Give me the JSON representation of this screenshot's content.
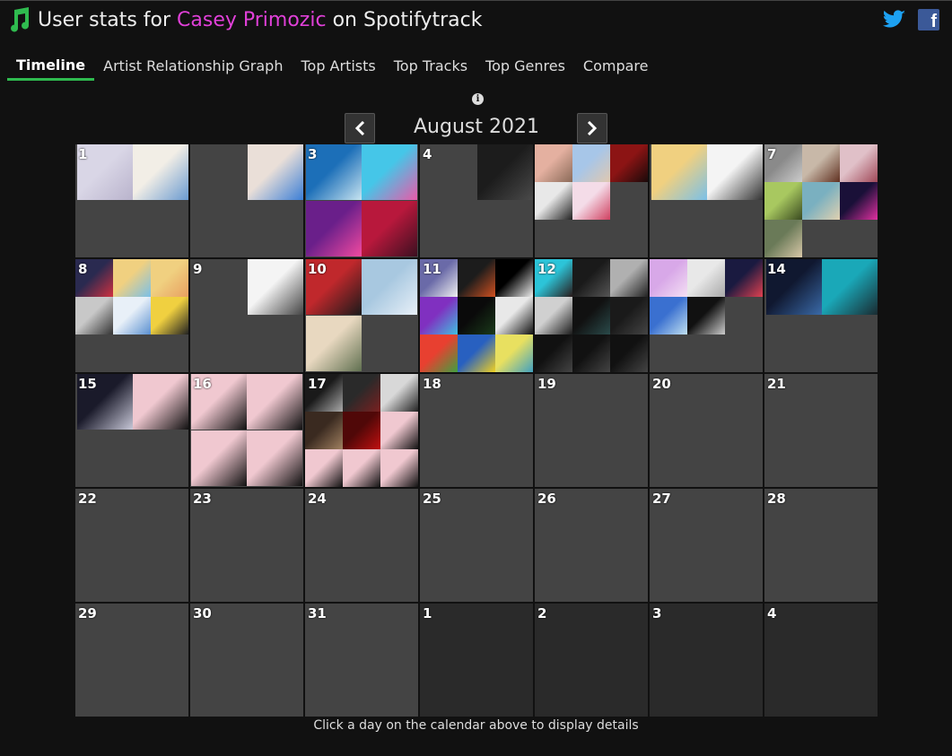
{
  "header": {
    "prefix": "User stats for ",
    "username": "Casey Primozic",
    "suffix": " on Spotifytrack"
  },
  "tabs": [
    {
      "label": "Timeline",
      "active": true
    },
    {
      "label": "Artist Relationship Graph"
    },
    {
      "label": "Top Artists"
    },
    {
      "label": "Top Tracks"
    },
    {
      "label": "Top Genres"
    },
    {
      "label": "Compare"
    }
  ],
  "calendar": {
    "month_label": "August 2021",
    "days": [
      {
        "label": "1",
        "art": [
          [
            "#d9d6e6",
            "#b9b3cc"
          ],
          [
            "#f2eee6",
            "#6a9ad0"
          ]
        ]
      },
      {
        "label": "",
        "art": [
          [
            "#eadfd8",
            "#3b7ed6"
          ]
        ]
      },
      {
        "label": "3",
        "art": [
          [
            "#1c6fb8",
            "#c8e4f0"
          ],
          [
            "#45c6e8",
            "#e85aa8"
          ],
          [
            "#6a1f8a",
            "#f24aa0"
          ],
          [
            "#b8183c",
            "#3b1020"
          ]
        ]
      },
      {
        "label": "4",
        "art": [
          [
            "#1c1c1c",
            "#4a4a4a"
          ]
        ]
      },
      {
        "label": "",
        "art": [
          [
            "#e4b0a0",
            "#8a6a58"
          ],
          [
            "#a7c6e8",
            "#e0c8b0"
          ],
          [
            "#8c1414",
            "#1a0a0a"
          ],
          [
            "#e8e8e8",
            "#222"
          ],
          [
            "#f4dce8",
            "#d04060"
          ]
        ]
      },
      {
        "label": "",
        "art": [
          [
            "#f0d080",
            "#7ac0e8"
          ],
          [
            "#f4f4f4",
            "#333"
          ]
        ]
      },
      {
        "label": "7",
        "art": [
          [
            "#8a8a8a",
            "#ccc"
          ],
          [
            "#c8b8a8",
            "#603020"
          ],
          [
            "#e0c0c8",
            "#a04858"
          ],
          [
            "#a8c860",
            "#3a4a20"
          ],
          [
            "#7ab0c0",
            "#e0d0b0"
          ],
          [
            "#1a1038",
            "#e030a0"
          ],
          [
            "#6a7a58",
            "#d8c8a8"
          ]
        ]
      },
      {
        "label": "8",
        "art": [
          [
            "#2a2a50",
            "#d03040"
          ],
          [
            "#f0d080",
            "#7ac0e8"
          ],
          [
            "#f0d080",
            "#e8a060"
          ],
          [
            "#c8c8c8",
            "#333"
          ],
          [
            "#e8f0f8",
            "#5a90d0"
          ],
          [
            "#f0d040",
            "#222"
          ]
        ]
      },
      {
        "label": "9",
        "art": [
          [
            "#f4f4f4",
            "#444"
          ]
        ]
      },
      {
        "label": "10",
        "art": [
          [
            "#c0282c",
            "#1a1a1a"
          ],
          [
            "#a8c8e0",
            "#e8f0f8"
          ],
          [
            "#e8d8c0",
            "#607050"
          ]
        ]
      },
      {
        "label": "11",
        "art": [
          [
            "#6a6aa8",
            "#f0f0f0"
          ],
          [
            "#1c1c1c",
            "#d05020"
          ],
          [
            "#000",
            "#eee"
          ],
          [
            "#8030c0",
            "#40c0e0"
          ],
          [
            "#0a0a0a",
            "#1a3a1a"
          ],
          [
            "#e8e8e8",
            "#111"
          ],
          [
            "#e84030",
            "#40a040"
          ],
          [
            "#2860c0",
            "#f0d020"
          ],
          [
            "#e8e060",
            "#40a0c0"
          ]
        ]
      },
      {
        "label": "12",
        "art": [
          [
            "#2cc4d8",
            "#2a1a1a"
          ],
          [
            "#1a1a1a",
            "#555"
          ],
          [
            "#b0b0b0",
            "#222"
          ],
          [
            "#d0d0d0",
            "#1a1a1a"
          ],
          [
            "#111",
            "#2a4a4a"
          ],
          [
            "#1a1a1a",
            "#444"
          ],
          [
            "#111",
            "#444"
          ],
          [
            "#111",
            "#444"
          ],
          [
            "#111",
            "#444"
          ]
        ]
      },
      {
        "label": "",
        "art": [
          [
            "#d8a8e8",
            "#f4e0f4"
          ],
          [
            "#e8e8e8",
            "#a8a8a8"
          ],
          [
            "#1a1a40",
            "#e04050"
          ],
          [
            "#3a70d0",
            "#c0e0f0"
          ],
          [
            "#111",
            "#ccc"
          ]
        ]
      },
      {
        "label": "14",
        "art": [
          [
            "#101830",
            "#3a6aa8"
          ],
          [
            "#1aa8b8",
            "#1a2a30"
          ]
        ]
      },
      {
        "label": "15",
        "art": [
          [
            "#1a1a2a",
            "#c8c8d8"
          ],
          [
            "#f0c8d0",
            "#111"
          ]
        ]
      },
      {
        "label": "16",
        "art": [
          [
            "#f0c8d0",
            "#111"
          ],
          [
            "#f0c8d0",
            "#111"
          ],
          [
            "#f0c8d0",
            "#111"
          ],
          [
            "#f0c8d0",
            "#111"
          ]
        ]
      },
      {
        "label": "17",
        "art": [
          [
            "#1a1a1a",
            "#aaa"
          ],
          [
            "#2a2a2a",
            "#7a2020"
          ],
          [
            "#d8d8d8",
            "#222"
          ],
          [
            "#3a2a20",
            "#a08060"
          ],
          [
            "#500808",
            "#c01010"
          ],
          [
            "#f0c8d0",
            "#111"
          ],
          [
            "#f0c8d0",
            "#111"
          ],
          [
            "#f0c8d0",
            "#111"
          ],
          [
            "#f0c8d0",
            "#111"
          ]
        ]
      },
      {
        "label": "18",
        "art": []
      },
      {
        "label": "19",
        "art": []
      },
      {
        "label": "20",
        "art": []
      },
      {
        "label": "21",
        "art": []
      },
      {
        "label": "22",
        "art": []
      },
      {
        "label": "23",
        "art": []
      },
      {
        "label": "24",
        "art": []
      },
      {
        "label": "25",
        "art": []
      },
      {
        "label": "26",
        "art": []
      },
      {
        "label": "27",
        "art": []
      },
      {
        "label": "28",
        "art": []
      },
      {
        "label": "29",
        "art": []
      },
      {
        "label": "30",
        "art": []
      },
      {
        "label": "31",
        "art": []
      },
      {
        "label": "1",
        "other": true,
        "art": []
      },
      {
        "label": "2",
        "other": true,
        "art": []
      },
      {
        "label": "3",
        "other": true,
        "art": []
      },
      {
        "label": "4",
        "other": true,
        "art": []
      }
    ]
  },
  "footer": "Click a day on the calendar above to display details",
  "colors": {
    "accent_pink": "#e040d8",
    "tab_underline": "#2fbb4f",
    "music_icon": "#2fbb4f",
    "twitter": "#1da1f2",
    "facebook": "#3b5998"
  }
}
